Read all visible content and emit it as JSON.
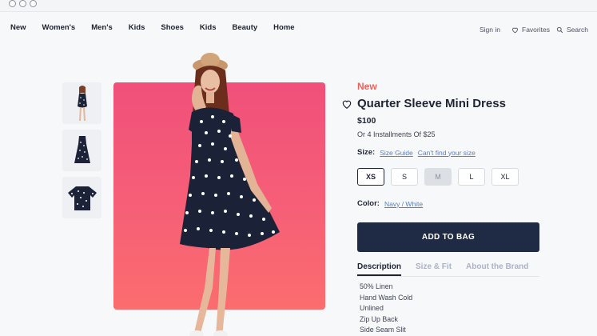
{
  "nav": {
    "items": [
      "New",
      "Women's",
      "Men's",
      "Kids",
      "Shoes",
      "Kids",
      "Beauty",
      "Home"
    ],
    "sign_in": "Sign in",
    "favorites": "Favorites",
    "search": "Search"
  },
  "product": {
    "badge": "New",
    "title": "Quarter Sleeve Mini Dress",
    "price": "$100",
    "installments": "Or 4 Installments Of $25",
    "size_label": "Size:",
    "size_guide": "Size Guide",
    "cant_find": "Can't find your size",
    "sizes": [
      "XS",
      "S",
      "M",
      "L",
      "XL"
    ],
    "selected_size": "XS",
    "unavailable_size": "M",
    "color_label": "Color:",
    "color_value": "Navy / White",
    "add_to_bag": "ADD TO BAG"
  },
  "tabs": [
    "Description",
    "Size & Fit",
    "About the Brand"
  ],
  "active_tab": "Description",
  "description": [
    "50% Linen",
    "Hand Wash Cold",
    "Unlined",
    "Zip Up Back",
    "Side Seam Slit"
  ],
  "colors": {
    "hero_gradient_top": "#f0507a",
    "hero_gradient_bottom": "#fb6d6e",
    "badge": "#f0605a",
    "button": "#1f2a44",
    "link": "#5b7fbe"
  }
}
